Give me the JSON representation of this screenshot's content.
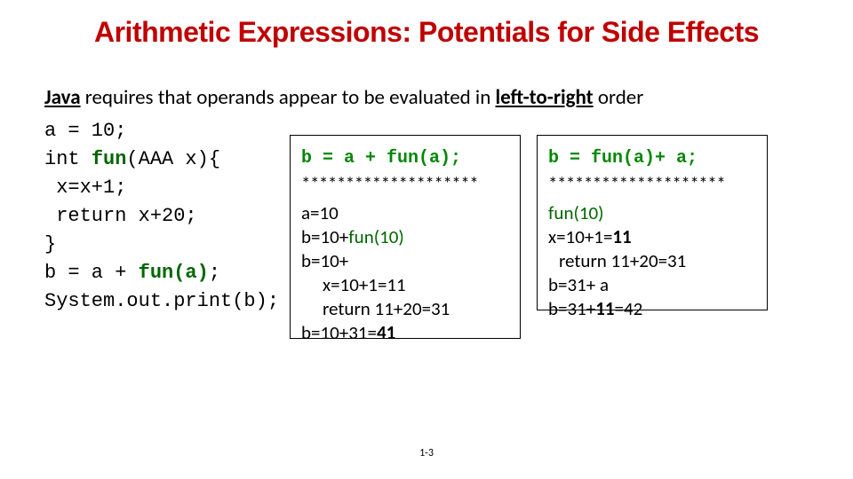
{
  "title": "Arithmetic Expressions: Potentials for Side Effects",
  "intro": {
    "java": "Java",
    "mid": " requires that operands appear to be evaluated in ",
    "ltr": "left-to-right",
    "end": " order"
  },
  "code": {
    "l1": "a = 10;",
    "l2a": "int ",
    "l2fn": "fun",
    "l2b": "(AAA x){",
    "l3": " x=x+1;",
    "l4": " return x+20;",
    "l5": "}",
    "l6a": "b = a + ",
    "l6fn": "fun(a)",
    "l6b": ";",
    "l7": "System.out.print(b);"
  },
  "box1": {
    "code": "b = a + fun(a);",
    "stars": "********************",
    "t1": "a=10",
    "t2a": "b=10+",
    "t2b": "fun(10)",
    "t3": "b=10+",
    "t4": "x=10+1=11",
    "t5": "return 11+20=31",
    "t6a": "b=10+31=",
    "t6b": "41"
  },
  "box2": {
    "code": "b = fun(a)+ a;",
    "stars": "********************",
    "t1": "fun(10)",
    "t2a": "x=10+1=",
    "t2b": "11",
    "t3": "return 11+20=31",
    "t4": "b=31+ a",
    "t5a": "b=31+",
    "t5b": "11",
    "t5c": "=42"
  },
  "page": "1-3"
}
